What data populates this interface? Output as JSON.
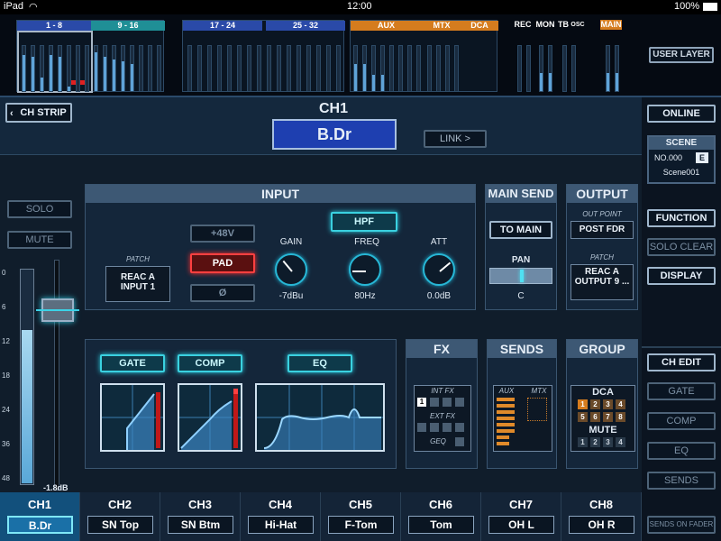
{
  "status": {
    "device": "iPad",
    "time": "12:00",
    "battery": "100%"
  },
  "overview": {
    "groups": [
      "1 - 8",
      "9 - 16",
      "17 - 24",
      "25 - 32",
      "AUX",
      "MTX",
      "DCA",
      "REC",
      "MON",
      "TB",
      "OSC",
      "MAIN"
    ]
  },
  "header": {
    "back": "CH STRIP",
    "channel": "CH1",
    "name": "B.Dr",
    "link": "LINK >"
  },
  "left": {
    "solo": "SOLO",
    "mute": "MUTE",
    "scale": [
      "0",
      "6",
      "12",
      "18",
      "24",
      "36",
      "48"
    ],
    "fader_value": "-1.8dB",
    "fader_level": 0.82,
    "meter_level": 0.72
  },
  "input": {
    "title": "INPUT",
    "patch_label": "PATCH",
    "patch_value": "REAC A INPUT 1",
    "phantom": "+48V",
    "pad": "PAD",
    "phase": "Ø",
    "hpf": "HPF",
    "gain_label": "GAIN",
    "gain_value": "-7dBu",
    "freq_label": "FREQ",
    "freq_value": "80Hz",
    "att_label": "ATT",
    "att_value": "0.0dB"
  },
  "main_send": {
    "title": "MAIN SEND",
    "to_main": "TO MAIN",
    "pan_label": "PAN",
    "pan_value": "C"
  },
  "output": {
    "title": "OUTPUT",
    "out_point_label": "OUT POINT",
    "out_point_value": "POST FDR",
    "patch_label": "PATCH",
    "patch_value": "REAC A OUTPUT 9 ..."
  },
  "dynamics": {
    "gate": "GATE",
    "comp": "COMP",
    "eq": "EQ"
  },
  "fx": {
    "title": "FX",
    "int_fx": "INT FX",
    "int_num": "1",
    "ext_fx": "EXT FX",
    "geq": "GEQ"
  },
  "sends": {
    "title": "SENDS",
    "aux": "AUX",
    "mtx": "MTX"
  },
  "group": {
    "title": "GROUP",
    "dca": "DCA",
    "dca_nums": [
      "1",
      "2",
      "3",
      "4",
      "5",
      "6",
      "7",
      "8"
    ],
    "mute": "MUTE",
    "mute_nums": [
      "1",
      "2",
      "3",
      "4"
    ]
  },
  "right": {
    "user_layer": "USER LAYER",
    "online": "ONLINE",
    "scene_label": "SCENE",
    "scene_no": "NO.000",
    "scene_badge": "E",
    "scene_name": "Scene001",
    "function": "FUNCTION",
    "solo_clear": "SOLO CLEAR",
    "display": "DISPLAY",
    "ch_edit": "CH EDIT",
    "gate": "GATE",
    "comp": "COMP",
    "eq": "EQ",
    "sends": "SENDS",
    "sends_on_fader": "SENDS ON FADER"
  },
  "channels": [
    {
      "ch": "CH1",
      "name": "B.Dr"
    },
    {
      "ch": "CH2",
      "name": "SN Top"
    },
    {
      "ch": "CH3",
      "name": "SN Btm"
    },
    {
      "ch": "CH4",
      "name": "Hi-Hat"
    },
    {
      "ch": "CH5",
      "name": "F-Tom"
    },
    {
      "ch": "CH6",
      "name": "Tom"
    },
    {
      "ch": "CH7",
      "name": "OH L"
    },
    {
      "ch": "CH8",
      "name": "OH R"
    }
  ],
  "colors": {
    "accent": "#3ad1e0",
    "pad_red": "#ff4040",
    "aux_orange": "#e08a2a",
    "mtx_orange": "#c87a2a",
    "dca_orange": "#d57c1e"
  }
}
